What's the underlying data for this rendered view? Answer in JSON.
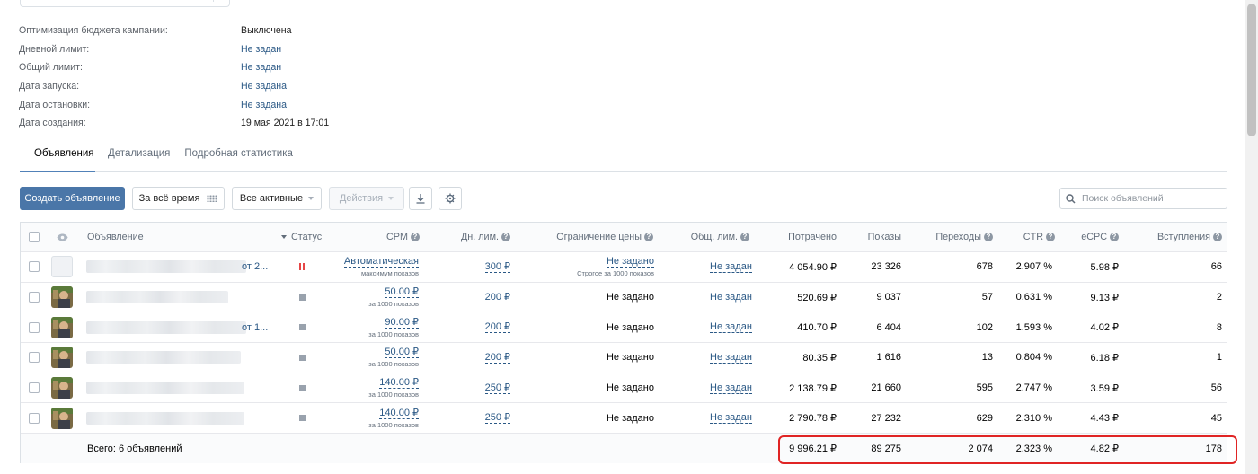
{
  "info": [
    {
      "label": "Оптимизация бюджета кампании:",
      "value": "Выключена",
      "link": false
    },
    {
      "label": "Дневной лимит:",
      "value": "Не задан",
      "link": true
    },
    {
      "label": "Общий лимит:",
      "value": "Не задан",
      "link": true
    },
    {
      "label": "Дата запуска:",
      "value": "Не задана",
      "link": true
    },
    {
      "label": "Дата остановки:",
      "value": "Не задана",
      "link": true
    },
    {
      "label": "Дата создания:",
      "value": "19 мая 2021 в 17:01",
      "link": false
    }
  ],
  "tabs": [
    "Объявления",
    "Детализация",
    "Подробная статистика"
  ],
  "toolbar": {
    "create": "Создать объявление",
    "period": "За всё время",
    "filter": "Все активные",
    "actions": "Действия",
    "search_placeholder": "Поиск объявлений"
  },
  "columns": {
    "ad": "Объявление",
    "status": "Статус",
    "cpm": "CPM",
    "daily": "Дн. лим.",
    "price_limit": "Ограничение цены",
    "total_limit": "Общ. лим.",
    "spent": "Потрачено",
    "impressions": "Показы",
    "clicks": "Переходы",
    "ctr": "CTR",
    "ecpc": "eCPC",
    "joins": "Вступления"
  },
  "rows": [
    {
      "name_suffix": "от 2...",
      "status": "paused",
      "cpm": "Автоматическая",
      "cpm_sub": "максимум показов",
      "daily": "300 ₽",
      "price_limit": "Не задано",
      "price_limit_sub": "Строгое за 1000 показов",
      "total_limit": "Не задан",
      "spent": "4 054.90 ₽",
      "impressions": "23 326",
      "clicks": "678",
      "ctr": "2.907 %",
      "ecpc": "5.98 ₽",
      "joins": "66"
    },
    {
      "name_suffix": "",
      "status": "stopped",
      "cpm": "50.00 ₽",
      "cpm_sub": "за 1000 показов",
      "daily": "200 ₽",
      "price_limit": "Не задано",
      "price_limit_sub": "",
      "total_limit": "Не задан",
      "spent": "520.69 ₽",
      "impressions": "9 037",
      "clicks": "57",
      "ctr": "0.631 %",
      "ecpc": "9.13 ₽",
      "joins": "2"
    },
    {
      "name_suffix": "от 1...",
      "status": "stopped",
      "cpm": "90.00 ₽",
      "cpm_sub": "за 1000 показов",
      "daily": "200 ₽",
      "price_limit": "Не задано",
      "price_limit_sub": "",
      "total_limit": "Не задан",
      "spent": "410.70 ₽",
      "impressions": "6 404",
      "clicks": "102",
      "ctr": "1.593 %",
      "ecpc": "4.02 ₽",
      "joins": "8"
    },
    {
      "name_suffix": "",
      "status": "stopped",
      "cpm": "50.00 ₽",
      "cpm_sub": "за 1000 показов",
      "daily": "200 ₽",
      "price_limit": "Не задано",
      "price_limit_sub": "",
      "total_limit": "Не задан",
      "spent": "80.35 ₽",
      "impressions": "1 616",
      "clicks": "13",
      "ctr": "0.804 %",
      "ecpc": "6.18 ₽",
      "joins": "1"
    },
    {
      "name_suffix": "",
      "status": "stopped",
      "cpm": "140.00 ₽",
      "cpm_sub": "за 1000 показов",
      "daily": "250 ₽",
      "price_limit": "Не задано",
      "price_limit_sub": "",
      "total_limit": "Не задан",
      "spent": "2 138.79 ₽",
      "impressions": "21 660",
      "clicks": "595",
      "ctr": "2.747 %",
      "ecpc": "3.59 ₽",
      "joins": "56"
    },
    {
      "name_suffix": "",
      "status": "stopped",
      "cpm": "140.00 ₽",
      "cpm_sub": "за 1000 показов",
      "daily": "250 ₽",
      "price_limit": "Не задано",
      "price_limit_sub": "",
      "total_limit": "Не задан",
      "spent": "2 790.78 ₽",
      "impressions": "27 232",
      "clicks": "629",
      "ctr": "2.310 %",
      "ecpc": "4.43 ₽",
      "joins": "45"
    }
  ],
  "total": {
    "label": "Всего: 6 объявлений",
    "spent": "9 996.21 ₽",
    "impressions": "89 275",
    "clicks": "2 074",
    "ctr": "2.323 %",
    "ecpc": "4.82 ₽",
    "joins": "178"
  },
  "colors": {
    "accent": "#4a76a8",
    "link": "#2a5885",
    "highlight": "#e02424",
    "paused": "#e64646"
  }
}
